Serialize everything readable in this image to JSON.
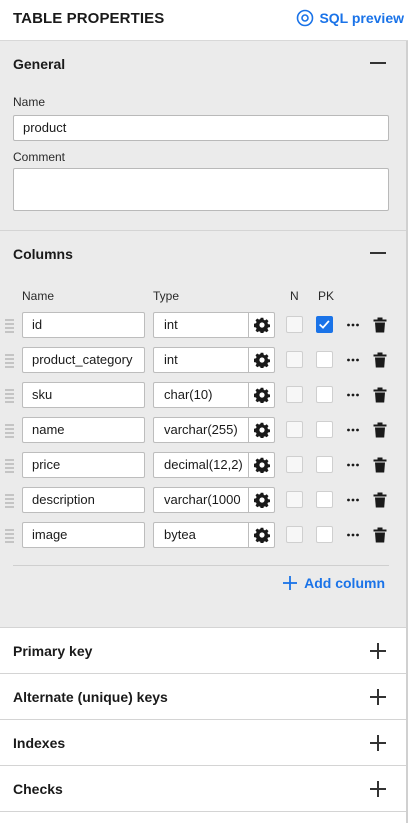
{
  "header": {
    "title": "TABLE PROPERTIES",
    "sql_preview_label": "SQL preview",
    "sql_preview_icon": "eye-icon",
    "accent_color": "#1a73e8"
  },
  "general": {
    "title": "General",
    "toggle_icon": "minus-icon",
    "name_label": "Name",
    "name_value": "product",
    "comment_label": "Comment",
    "comment_value": ""
  },
  "columns": {
    "title": "Columns",
    "toggle_icon": "minus-icon",
    "headers": {
      "name": "Name",
      "type": "Type",
      "n": "N",
      "pk": "PK"
    },
    "rows": [
      {
        "name": "id",
        "type": "int",
        "nullable": false,
        "pk": true
      },
      {
        "name": "product_category",
        "type": "int",
        "nullable": false,
        "pk": false
      },
      {
        "name": "sku",
        "type": "char(10)",
        "nullable": false,
        "pk": false
      },
      {
        "name": "name",
        "type": "varchar(255)",
        "nullable": false,
        "pk": false
      },
      {
        "name": "price",
        "type": "decimal(12,2)",
        "nullable": false,
        "pk": false
      },
      {
        "name": "description",
        "type": "varchar(1000",
        "nullable": false,
        "pk": false
      },
      {
        "name": "image",
        "type": "bytea",
        "nullable": false,
        "pk": false
      }
    ],
    "add_column_label": "Add column"
  },
  "collapsed_sections": [
    {
      "title": "Primary key",
      "toggle_icon": "plus-icon"
    },
    {
      "title": "Alternate (unique) keys",
      "toggle_icon": "plus-icon"
    },
    {
      "title": "Indexes",
      "toggle_icon": "plus-icon"
    },
    {
      "title": "Checks",
      "toggle_icon": "plus-icon"
    }
  ]
}
